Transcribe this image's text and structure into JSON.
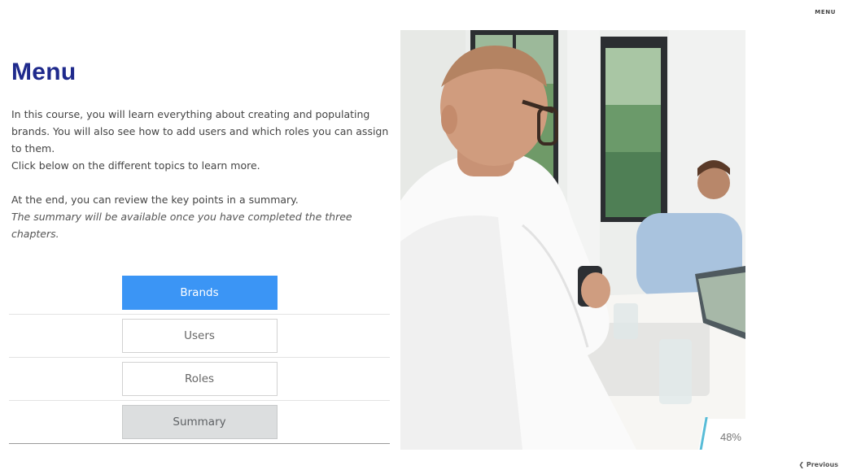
{
  "header": {
    "menu_label": "MENU"
  },
  "page": {
    "title": "Menu",
    "intro": {
      "line1": "In this course, you will learn everything about creating and populating brands. You will also see how to add users and which roles you can assign to them.",
      "line2": "Click below on the different topics to learn more.",
      "line3": "At the end, you can review the key points in a summary.",
      "line4": "The summary will be available once you have completed the three chapters."
    }
  },
  "menu": {
    "items": [
      {
        "label": "Brands",
        "state": "active"
      },
      {
        "label": "Users",
        "state": "default"
      },
      {
        "label": "Roles",
        "state": "default"
      },
      {
        "label": "Summary",
        "state": "disabled"
      }
    ]
  },
  "photo": {
    "progress": "48%"
  },
  "footer": {
    "previous_label": "❮ Previous"
  },
  "colors": {
    "title": "#1f2a8c",
    "accent": "#3b95f5",
    "progress_edge": "#58bcd7",
    "disabled_bg": "#dcdedf"
  },
  "icons": {
    "previous": "chevron-left-icon"
  }
}
